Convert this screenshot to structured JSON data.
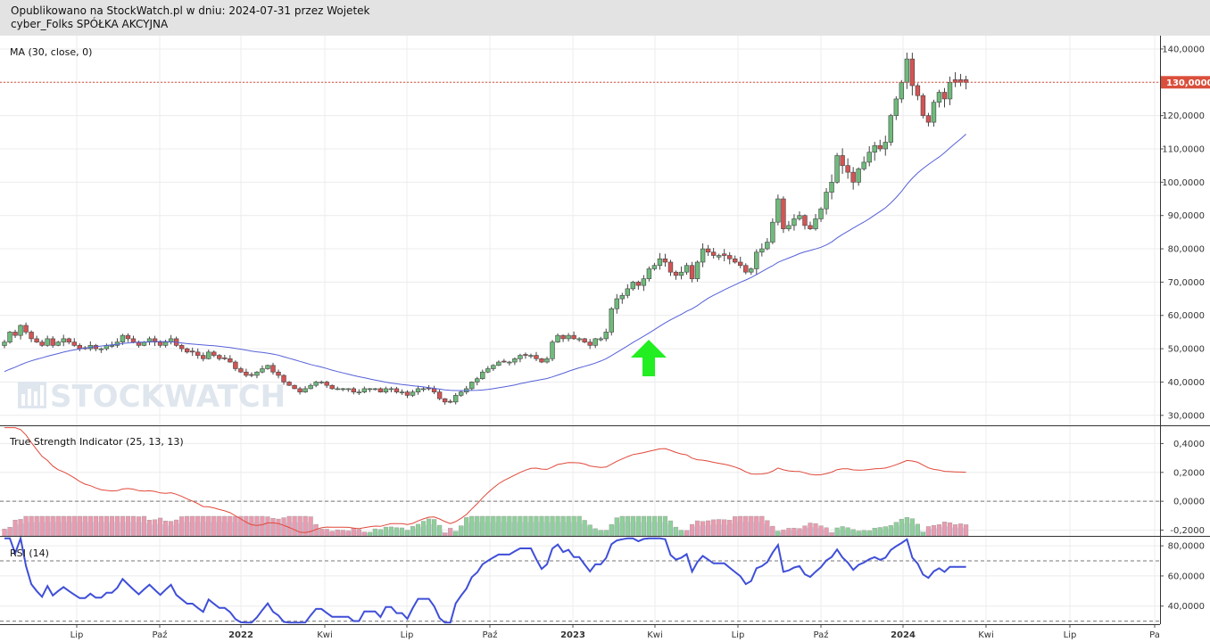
{
  "header": {
    "line1": "Opublikowano na StockWatch.pl w dniu: 2024-07-31 przez Wojetek",
    "line2": "cyber_Folks SPÓŁKA AKCYJNA"
  },
  "watermark": "STOCKWATCH",
  "colors": {
    "up": "#6fba7c",
    "down": "#d45454",
    "ma": "#5560d8",
    "tsi": "#e0483a",
    "rsi": "#3f4fd8",
    "arrow": "#22ee22",
    "price_tag": "#d94f3c",
    "hist_up": "#8ed09a",
    "hist_down": "#ea9bb0",
    "hist_area": "#b9c9ef"
  },
  "chart_data": [
    {
      "type": "candlestick",
      "title": "MA (30, close, 0)",
      "x_labels": [
        "Lip",
        "Paź",
        "2022",
        "Kwi",
        "Lip",
        "Paź",
        "2023",
        "Kwi",
        "Lip",
        "Paź",
        "2024",
        "Kwi",
        "Lip",
        "Pa"
      ],
      "ylim": [
        27000,
        144000
      ],
      "y_ticks": [
        {
          "value": 140000,
          "label": "140,0000"
        },
        {
          "value": 130000,
          "label": "130,0000"
        },
        {
          "value": 120000,
          "label": "120,0000"
        },
        {
          "value": 110000,
          "label": "110,0000"
        },
        {
          "value": 100000,
          "label": "100,0000"
        },
        {
          "value": 90000,
          "label": "90,0000"
        },
        {
          "value": 80000,
          "label": "80,0000"
        },
        {
          "value": 70000,
          "label": "70,0000"
        },
        {
          "value": 60000,
          "label": "60,0000"
        },
        {
          "value": 50000,
          "label": "50,0000"
        },
        {
          "value": 40000,
          "label": "40,0000"
        },
        {
          "value": 30000,
          "label": "30,0000"
        }
      ],
      "last_price": {
        "value": 130000,
        "label": "130,0000"
      },
      "closes": [
        52000,
        55000,
        54000,
        57000,
        55000,
        53000,
        52000,
        51000,
        53000,
        51000,
        52000,
        53000,
        52000,
        51000,
        50000,
        50000,
        51000,
        50000,
        50000,
        51000,
        51000,
        52000,
        54000,
        53000,
        52000,
        51000,
        52000,
        53000,
        52000,
        51000,
        52000,
        53000,
        51000,
        50000,
        49000,
        49000,
        48000,
        47000,
        49000,
        48000,
        47000,
        47000,
        46000,
        44000,
        43000,
        42000,
        42000,
        43000,
        44000,
        45000,
        43000,
        42000,
        40000,
        39000,
        38000,
        37000,
        38000,
        39000,
        40000,
        40000,
        39000,
        38000,
        38000,
        38000,
        38000,
        37000,
        37000,
        38000,
        38000,
        38000,
        37000,
        38000,
        38000,
        37000,
        37000,
        36000,
        37000,
        38000,
        38000,
        38000,
        37000,
        35000,
        34000,
        34000,
        36000,
        37000,
        38000,
        40000,
        41000,
        43000,
        44000,
        45000,
        46000,
        46000,
        46000,
        47000,
        48000,
        48000,
        48000,
        47000,
        46000,
        47000,
        52000,
        54000,
        53000,
        54000,
        53000,
        53000,
        52000,
        51000,
        53000,
        53000,
        55000,
        62000,
        65000,
        66000,
        68000,
        70000,
        69000,
        71000,
        74000,
        75000,
        77000,
        76000,
        73000,
        72000,
        73000,
        75000,
        71000,
        76000,
        80000,
        79000,
        78000,
        78000,
        78000,
        77000,
        76000,
        75000,
        73000,
        74000,
        79000,
        80000,
        82000,
        88000,
        95000,
        86000,
        87000,
        89000,
        90000,
        87000,
        86000,
        89000,
        92000,
        97000,
        100000,
        108000,
        105000,
        103000,
        100000,
        104000,
        106000,
        109000,
        111000,
        110000,
        112000,
        120000,
        125000,
        130000,
        137000,
        129000,
        126000,
        120000,
        118000,
        124000,
        127000,
        125000,
        130000,
        130000,
        130000,
        130000
      ],
      "ma_period": 30
    },
    {
      "type": "line+histogram",
      "title": "True Strength Indicator (25, 13, 13)",
      "ylim": [
        -0.24,
        0.52
      ],
      "y_ticks": [
        {
          "value": 0.4,
          "label": "0,4000"
        },
        {
          "value": 0.2,
          "label": "0,2000"
        },
        {
          "value": 0.0,
          "label": "0,0000"
        },
        {
          "value": -0.2,
          "label": "-0,2000"
        }
      ],
      "zero_line": 0
    },
    {
      "type": "line",
      "title": "RSI (14)",
      "ylim": [
        28,
        86
      ],
      "y_ticks": [
        {
          "value": 80,
          "label": "80,0000"
        },
        {
          "value": 60,
          "label": "60,0000"
        },
        {
          "value": 40,
          "label": "40,0000"
        }
      ],
      "levels": [
        70,
        30
      ],
      "period": 14
    }
  ]
}
